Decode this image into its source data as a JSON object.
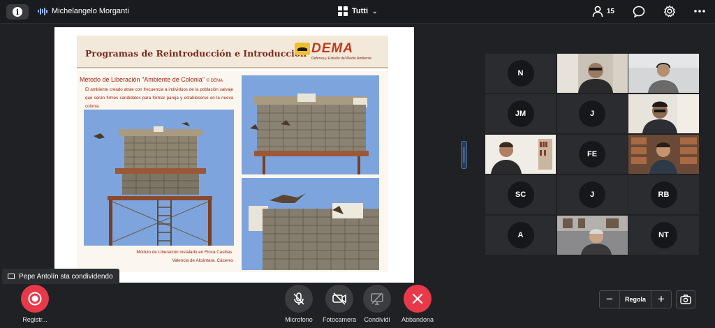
{
  "topbar": {
    "speaker_name": "Michelangelo Morganti",
    "layout_label": "Tutti",
    "participant_count": "15",
    "icons": [
      "info-icon",
      "audio-wave-icon",
      "grid-layout-icon",
      "chevron-down-icon",
      "people-icon",
      "chat-icon",
      "gear-icon",
      "more-icon"
    ]
  },
  "slide": {
    "title": "Programas de Reintroducción e Introducción",
    "logo_word": "DEMA",
    "logo_subtitle": "Defensa y Estudio del Medio Ambiente",
    "method_title": "Método de Liberación \"Ambiente de Colonia\"",
    "method_credit": "© DEMA",
    "method_text": "El ambiente creado atrae con frecuencia a individuos de la población salvaje que serán firmes candidatos para formar pareja y establecerse en la nueva colonia",
    "caption_line1": "Módulo de Liberación instalado en Finca Casillas.",
    "caption_line2": "Valencia de Alcántara. Cáceres"
  },
  "participants": [
    {
      "initials": "N",
      "video": false
    },
    {
      "initials": "",
      "video": true
    },
    {
      "initials": "",
      "video": true
    },
    {
      "initials": "JM",
      "video": false
    },
    {
      "initials": "J",
      "video": false
    },
    {
      "initials": "",
      "video": true
    },
    {
      "initials": "",
      "video": true
    },
    {
      "initials": "FE",
      "video": false
    },
    {
      "initials": "",
      "video": true
    },
    {
      "initials": "SC",
      "video": false
    },
    {
      "initials": "J",
      "video": false
    },
    {
      "initials": "RB",
      "video": false
    },
    {
      "initials": "A",
      "video": false
    },
    {
      "initials": "",
      "video": true
    },
    {
      "initials": "NT",
      "video": false
    }
  ],
  "toast": {
    "text": "Pepe Antolín sta condividendo"
  },
  "controls": {
    "record_label": "Registr...",
    "mic_label": "Microfono",
    "camera_label": "Fotocamera",
    "share_label": "Condividi",
    "leave_label": "Abbandona"
  },
  "zoom": {
    "label": "Regola",
    "minus": "−",
    "plus": "+"
  },
  "colors": {
    "record": "#e8394a",
    "leave": "#e8394a",
    "control_gray": "#3c3d41",
    "accent": "#9ab8ff"
  }
}
